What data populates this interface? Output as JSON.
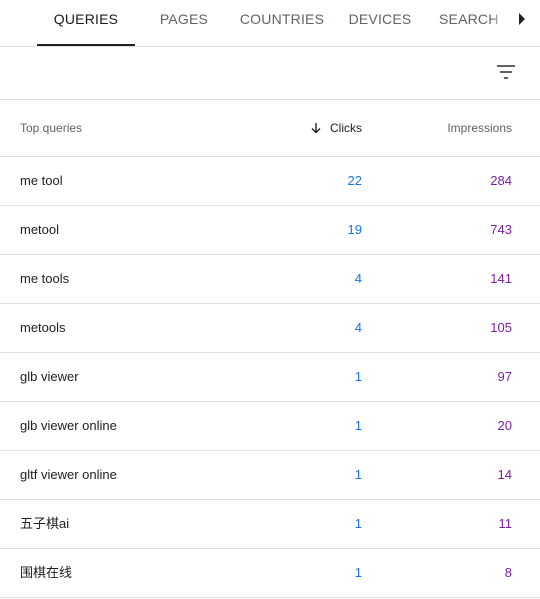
{
  "tabs": {
    "items": [
      {
        "label": "QUERIES"
      },
      {
        "label": "PAGES"
      },
      {
        "label": "COUNTRIES"
      },
      {
        "label": "DEVICES"
      },
      {
        "label": "SEARCH APPEARANCE"
      }
    ],
    "active": "QUERIES",
    "scroll_icon": "arrow-right-icon"
  },
  "toolbar": {
    "filter_icon": "filter-icon"
  },
  "table": {
    "headers": {
      "query": "Top queries",
      "clicks": "Clicks",
      "impressions": "Impressions"
    },
    "sort": {
      "column": "clicks",
      "direction": "descending",
      "icon": "arrow-down-icon"
    },
    "rows": [
      {
        "query": "me tool",
        "clicks": "22",
        "impressions": "284"
      },
      {
        "query": "metool",
        "clicks": "19",
        "impressions": "743"
      },
      {
        "query": "me tools",
        "clicks": "4",
        "impressions": "141"
      },
      {
        "query": "metools",
        "clicks": "4",
        "impressions": "105"
      },
      {
        "query": "glb viewer",
        "clicks": "1",
        "impressions": "97"
      },
      {
        "query": "glb viewer online",
        "clicks": "1",
        "impressions": "20"
      },
      {
        "query": "gltf viewer online",
        "clicks": "1",
        "impressions": "14"
      },
      {
        "query": "五子棋ai",
        "clicks": "1",
        "impressions": "11"
      },
      {
        "query": "围棋在线",
        "clicks": "1",
        "impressions": "8"
      }
    ]
  },
  "colors": {
    "clicks": "#1a73e8",
    "impressions": "#7b1fa2",
    "divider": "#e0e0e0",
    "active_tab_indicator": "#202124"
  }
}
